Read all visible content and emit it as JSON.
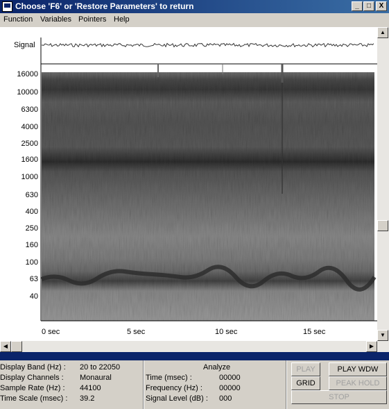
{
  "window": {
    "title": "Choose 'F6' or 'Restore Parameters' to return",
    "min": "_",
    "max": "□",
    "close": "X"
  },
  "menu": [
    "Function",
    "Variables",
    "Pointers",
    "Help"
  ],
  "plot": {
    "signal_label": "Signal",
    "freq_labels": [
      "16000",
      "10000",
      "6300",
      "4000",
      "2500",
      "1600",
      "1000",
      "630",
      "400",
      "250",
      "160",
      "100",
      "63",
      "40"
    ],
    "time_labels": [
      "0  sec",
      "5  sec",
      "10  sec",
      "15  sec"
    ]
  },
  "status": {
    "band_label": "Display Band (Hz) :",
    "band_value": "20 to 22050",
    "channels_label": "Display Channels :",
    "channels_value": "Monaural",
    "rate_label": "Sample Rate (Hz) :",
    "rate_value": "44100",
    "scale_label": "Time Scale (msec) :",
    "scale_value": "39.2",
    "analyze_title": "Analyze",
    "time_label": "Time (msec) :",
    "time_value": "00000",
    "freq_label": "Frequency (Hz) :",
    "freq_value": "00000",
    "level_label": "Signal Level (dB) :",
    "level_value": "000"
  },
  "buttons": {
    "play": "PLAY",
    "play_wdw": "PLAY WDW",
    "grid": "GRID",
    "peak_hold": "PEAK HOLD",
    "stop": "STOP"
  },
  "colors": {
    "title_bar": "#0a246a",
    "face": "#d4d0c8"
  }
}
